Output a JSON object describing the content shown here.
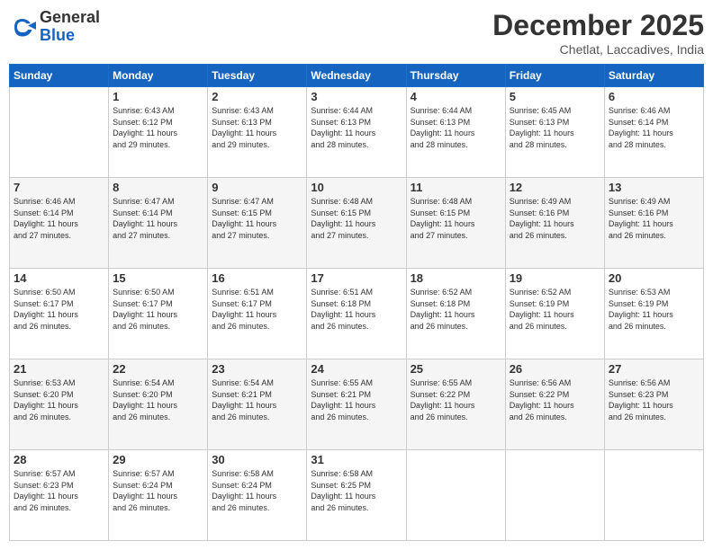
{
  "header": {
    "logo_general": "General",
    "logo_blue": "Blue",
    "month_title": "December 2025",
    "subtitle": "Chetlat, Laccadives, India"
  },
  "days_of_week": [
    "Sunday",
    "Monday",
    "Tuesday",
    "Wednesday",
    "Thursday",
    "Friday",
    "Saturday"
  ],
  "weeks": [
    [
      {
        "day": "",
        "info": ""
      },
      {
        "day": "1",
        "info": "Sunrise: 6:43 AM\nSunset: 6:12 PM\nDaylight: 11 hours\nand 29 minutes."
      },
      {
        "day": "2",
        "info": "Sunrise: 6:43 AM\nSunset: 6:13 PM\nDaylight: 11 hours\nand 29 minutes."
      },
      {
        "day": "3",
        "info": "Sunrise: 6:44 AM\nSunset: 6:13 PM\nDaylight: 11 hours\nand 28 minutes."
      },
      {
        "day": "4",
        "info": "Sunrise: 6:44 AM\nSunset: 6:13 PM\nDaylight: 11 hours\nand 28 minutes."
      },
      {
        "day": "5",
        "info": "Sunrise: 6:45 AM\nSunset: 6:13 PM\nDaylight: 11 hours\nand 28 minutes."
      },
      {
        "day": "6",
        "info": "Sunrise: 6:46 AM\nSunset: 6:14 PM\nDaylight: 11 hours\nand 28 minutes."
      }
    ],
    [
      {
        "day": "7",
        "info": "Sunrise: 6:46 AM\nSunset: 6:14 PM\nDaylight: 11 hours\nand 27 minutes."
      },
      {
        "day": "8",
        "info": "Sunrise: 6:47 AM\nSunset: 6:14 PM\nDaylight: 11 hours\nand 27 minutes."
      },
      {
        "day": "9",
        "info": "Sunrise: 6:47 AM\nSunset: 6:15 PM\nDaylight: 11 hours\nand 27 minutes."
      },
      {
        "day": "10",
        "info": "Sunrise: 6:48 AM\nSunset: 6:15 PM\nDaylight: 11 hours\nand 27 minutes."
      },
      {
        "day": "11",
        "info": "Sunrise: 6:48 AM\nSunset: 6:15 PM\nDaylight: 11 hours\nand 27 minutes."
      },
      {
        "day": "12",
        "info": "Sunrise: 6:49 AM\nSunset: 6:16 PM\nDaylight: 11 hours\nand 26 minutes."
      },
      {
        "day": "13",
        "info": "Sunrise: 6:49 AM\nSunset: 6:16 PM\nDaylight: 11 hours\nand 26 minutes."
      }
    ],
    [
      {
        "day": "14",
        "info": "Sunrise: 6:50 AM\nSunset: 6:17 PM\nDaylight: 11 hours\nand 26 minutes."
      },
      {
        "day": "15",
        "info": "Sunrise: 6:50 AM\nSunset: 6:17 PM\nDaylight: 11 hours\nand 26 minutes."
      },
      {
        "day": "16",
        "info": "Sunrise: 6:51 AM\nSunset: 6:17 PM\nDaylight: 11 hours\nand 26 minutes."
      },
      {
        "day": "17",
        "info": "Sunrise: 6:51 AM\nSunset: 6:18 PM\nDaylight: 11 hours\nand 26 minutes."
      },
      {
        "day": "18",
        "info": "Sunrise: 6:52 AM\nSunset: 6:18 PM\nDaylight: 11 hours\nand 26 minutes."
      },
      {
        "day": "19",
        "info": "Sunrise: 6:52 AM\nSunset: 6:19 PM\nDaylight: 11 hours\nand 26 minutes."
      },
      {
        "day": "20",
        "info": "Sunrise: 6:53 AM\nSunset: 6:19 PM\nDaylight: 11 hours\nand 26 minutes."
      }
    ],
    [
      {
        "day": "21",
        "info": "Sunrise: 6:53 AM\nSunset: 6:20 PM\nDaylight: 11 hours\nand 26 minutes."
      },
      {
        "day": "22",
        "info": "Sunrise: 6:54 AM\nSunset: 6:20 PM\nDaylight: 11 hours\nand 26 minutes."
      },
      {
        "day": "23",
        "info": "Sunrise: 6:54 AM\nSunset: 6:21 PM\nDaylight: 11 hours\nand 26 minutes."
      },
      {
        "day": "24",
        "info": "Sunrise: 6:55 AM\nSunset: 6:21 PM\nDaylight: 11 hours\nand 26 minutes."
      },
      {
        "day": "25",
        "info": "Sunrise: 6:55 AM\nSunset: 6:22 PM\nDaylight: 11 hours\nand 26 minutes."
      },
      {
        "day": "26",
        "info": "Sunrise: 6:56 AM\nSunset: 6:22 PM\nDaylight: 11 hours\nand 26 minutes."
      },
      {
        "day": "27",
        "info": "Sunrise: 6:56 AM\nSunset: 6:23 PM\nDaylight: 11 hours\nand 26 minutes."
      }
    ],
    [
      {
        "day": "28",
        "info": "Sunrise: 6:57 AM\nSunset: 6:23 PM\nDaylight: 11 hours\nand 26 minutes."
      },
      {
        "day": "29",
        "info": "Sunrise: 6:57 AM\nSunset: 6:24 PM\nDaylight: 11 hours\nand 26 minutes."
      },
      {
        "day": "30",
        "info": "Sunrise: 6:58 AM\nSunset: 6:24 PM\nDaylight: 11 hours\nand 26 minutes."
      },
      {
        "day": "31",
        "info": "Sunrise: 6:58 AM\nSunset: 6:25 PM\nDaylight: 11 hours\nand 26 minutes."
      },
      {
        "day": "",
        "info": ""
      },
      {
        "day": "",
        "info": ""
      },
      {
        "day": "",
        "info": ""
      }
    ]
  ]
}
